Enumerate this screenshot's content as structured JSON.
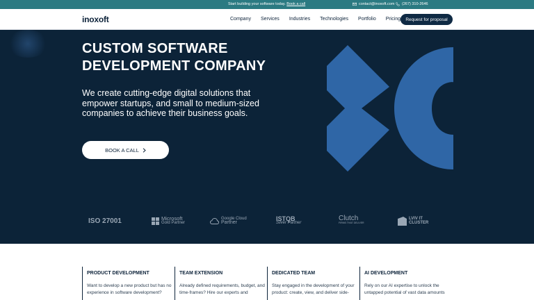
{
  "topbar": {
    "promo_text": "Start building your software today.",
    "promo_link": "Book a call",
    "email": "contact@inoxoft.com",
    "phone": "(267) 310-2646"
  },
  "header": {
    "logo": "inoxoft",
    "nav": [
      "Company",
      "Services",
      "Industries",
      "Technologies",
      "Portfolio",
      "Pricing"
    ],
    "cta": "Request for proposal"
  },
  "hero": {
    "title": "CUSTOM SOFTWARE DEVELOPMENT COMPANY",
    "subtitle": "We create cutting-edge digital solutions that empower startups, and small to medium-sized companies to achieve their business goals.",
    "button": "BOOK A CALL"
  },
  "partners": [
    {
      "line1": "ISO 27001"
    },
    {
      "line1": "Microsoft",
      "line2": "Gold Partner"
    },
    {
      "line1": "Google Cloud",
      "line2": "Partner"
    },
    {
      "line1": "ISTQB",
      "line2": "Silver Partner"
    },
    {
      "line1": "Clutch",
      "line2": "FIRMS THAT DELIVER"
    },
    {
      "line1": "LVIV IT",
      "line2": "CLUSTER"
    }
  ],
  "services": [
    {
      "title": "PRODUCT DEVELOPMENT",
      "text": "Want to develop a new product but has no experience in software development?"
    },
    {
      "title": "TEAM EXTENSION",
      "text": "Already defined requirements, budget, and time-frames? Hire our experts and"
    },
    {
      "title": "DEDICATED TEAM",
      "text": "Stay engaged in the development of your product: create, view, and deliver side-"
    },
    {
      "title": "AI DEVELOPMENT",
      "text": "Rely on our AI expertise to unlock the untapped potential of vast data amounts"
    }
  ],
  "colors": {
    "topbar": "#2b7a82",
    "hero_bg": "#0c2338",
    "accent": "#2f66a6",
    "dark": "#0c2239"
  }
}
